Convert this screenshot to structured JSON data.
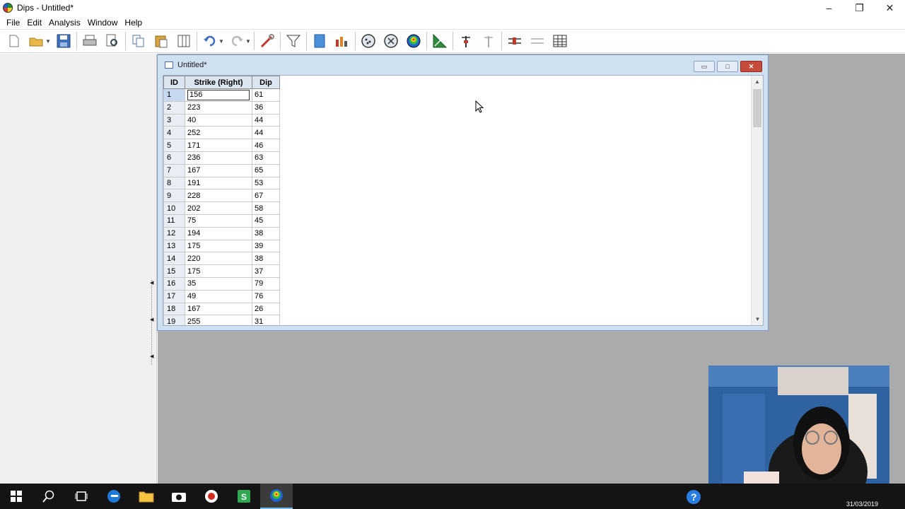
{
  "app": {
    "title": "Dips - Untitled*"
  },
  "window_controls": {
    "minimize": "–",
    "restore": "❐",
    "close": "✕"
  },
  "menu": [
    "File",
    "Edit",
    "Analysis",
    "Window",
    "Help"
  ],
  "toolbar_icons": [
    "new-file-icon",
    "open-folder-icon",
    "save-icon",
    "print-icon",
    "print-preview-icon",
    "copy-icon",
    "paste-icon",
    "columns-icon",
    "undo-icon",
    "redo-icon",
    "tools-icon",
    "filter-icon",
    "book-icon",
    "chart-icon",
    "pole-plot-icon",
    "scatter-plot-icon",
    "contour-plot-icon",
    "rosette-icon",
    "add-plane-icon",
    "delete-plane-icon",
    "add-set-icon",
    "delete-set-icon",
    "table-icon"
  ],
  "child_window": {
    "title": "Untitled*",
    "controls": {
      "minimize": "▭",
      "maximize": "□",
      "close": "✕"
    }
  },
  "grid": {
    "headers": {
      "id": "ID",
      "strike": "Strike (Right)",
      "dip": "Dip"
    },
    "rows": [
      {
        "id": "1",
        "strike": "156",
        "dip": "61"
      },
      {
        "id": "2",
        "strike": "223",
        "dip": "36"
      },
      {
        "id": "3",
        "strike": "40",
        "dip": "44"
      },
      {
        "id": "4",
        "strike": "252",
        "dip": "44"
      },
      {
        "id": "5",
        "strike": "171",
        "dip": "46"
      },
      {
        "id": "6",
        "strike": "236",
        "dip": "63"
      },
      {
        "id": "7",
        "strike": "167",
        "dip": "65"
      },
      {
        "id": "8",
        "strike": "191",
        "dip": "53"
      },
      {
        "id": "9",
        "strike": "228",
        "dip": "67"
      },
      {
        "id": "10",
        "strike": "202",
        "dip": "58"
      },
      {
        "id": "11",
        "strike": "75",
        "dip": "45"
      },
      {
        "id": "12",
        "strike": "194",
        "dip": "38"
      },
      {
        "id": "13",
        "strike": "175",
        "dip": "39"
      },
      {
        "id": "14",
        "strike": "220",
        "dip": "38"
      },
      {
        "id": "15",
        "strike": "175",
        "dip": "37"
      },
      {
        "id": "16",
        "strike": "35",
        "dip": "79"
      },
      {
        "id": "17",
        "strike": "49",
        "dip": "76"
      },
      {
        "id": "18",
        "strike": "167",
        "dip": "26"
      },
      {
        "id": "19",
        "strike": "255",
        "dip": "31"
      }
    ]
  },
  "taskbar": {
    "icons": [
      "windows-start-icon",
      "search-icon",
      "task-view-icon",
      "edge-icon",
      "file-explorer-icon",
      "camera-icon",
      "record-icon",
      "green-app-icon",
      "dips-icon"
    ],
    "date": "31/03/2019"
  }
}
